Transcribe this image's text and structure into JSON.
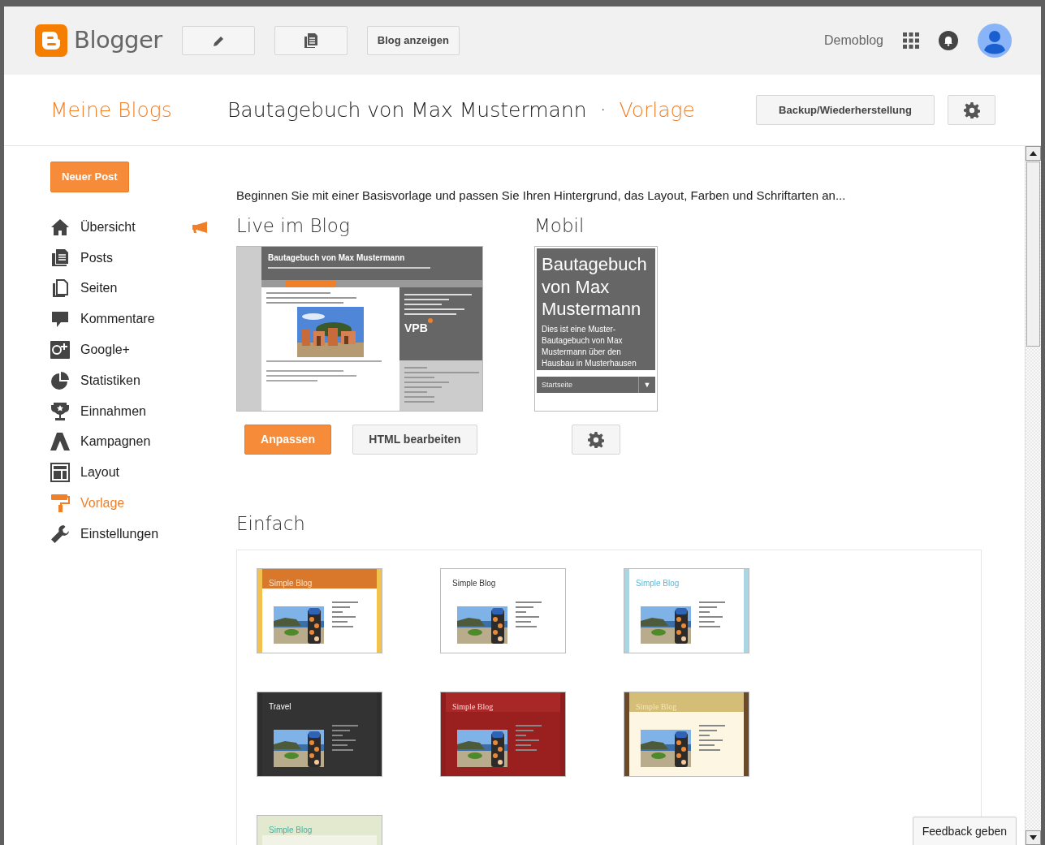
{
  "header": {
    "logo_text": "Blogger",
    "view_button": "Blog anzeigen",
    "blog_name": "Demoblog"
  },
  "title_bar": {
    "my_blogs": "Meine Blogs",
    "blog_title": "Bautagebuch von Max Mustermann",
    "separator": "·",
    "section": "Vorlage",
    "backup_button": "Backup/Wiederherstellung"
  },
  "sidebar": {
    "new_post_button": "Neuer Post",
    "items": [
      {
        "kind": "overview",
        "label": "Übersicht",
        "selected": false,
        "notice": true
      },
      {
        "kind": "posts",
        "label": "Posts",
        "selected": false,
        "notice": false
      },
      {
        "kind": "pages",
        "label": "Seiten",
        "selected": false,
        "notice": false
      },
      {
        "kind": "comments",
        "label": "Kommentare",
        "selected": false,
        "notice": false
      },
      {
        "kind": "gplus",
        "label": "Google+",
        "selected": false,
        "notice": false
      },
      {
        "kind": "stats",
        "label": "Statistiken",
        "selected": false,
        "notice": false
      },
      {
        "kind": "earnings",
        "label": "Einnahmen",
        "selected": false,
        "notice": false
      },
      {
        "kind": "campaigns",
        "label": "Kampagnen",
        "selected": false,
        "notice": false
      },
      {
        "kind": "layout",
        "label": "Layout",
        "selected": false,
        "notice": false
      },
      {
        "kind": "template",
        "label": "Vorlage",
        "selected": true,
        "notice": false
      },
      {
        "kind": "settings",
        "label": "Einstellungen",
        "selected": false,
        "notice": false
      }
    ]
  },
  "intro": "Beginnen Sie mit einer Basisvorlage und passen Sie Ihren Hintergrund, das Layout, Farben und Schriftarten an...",
  "live": {
    "heading": "Live im Blog",
    "preview": {
      "title": "Bautagebuch von Max Mustermann",
      "logo": "VPB"
    },
    "customize_button": "Anpassen",
    "edit_html_button": "HTML bearbeiten"
  },
  "mobile": {
    "heading": "Mobil",
    "preview": {
      "title": "Bautagebuch von Max Mustermann",
      "description": "Dies ist eine Muster-Bautagebuch von Max Mustermann über den Hausbau in Musterhausen",
      "menu_item": "Startseite",
      "menu_arrow": "▼"
    }
  },
  "simple": {
    "heading": "Einfach",
    "templates": [
      {
        "kind": "orange",
        "title": "Simple Blog"
      },
      {
        "kind": "white",
        "title": "Simple Blog"
      },
      {
        "kind": "sky",
        "title": "Simple Blog"
      },
      {
        "kind": "travel",
        "title": "Travel"
      },
      {
        "kind": "red",
        "title": "Simple Blog"
      },
      {
        "kind": "sand",
        "title": "Simple Blog"
      },
      {
        "kind": "green",
        "title": "Simple Blog"
      }
    ]
  },
  "feedback_button": "Feedback geben"
}
